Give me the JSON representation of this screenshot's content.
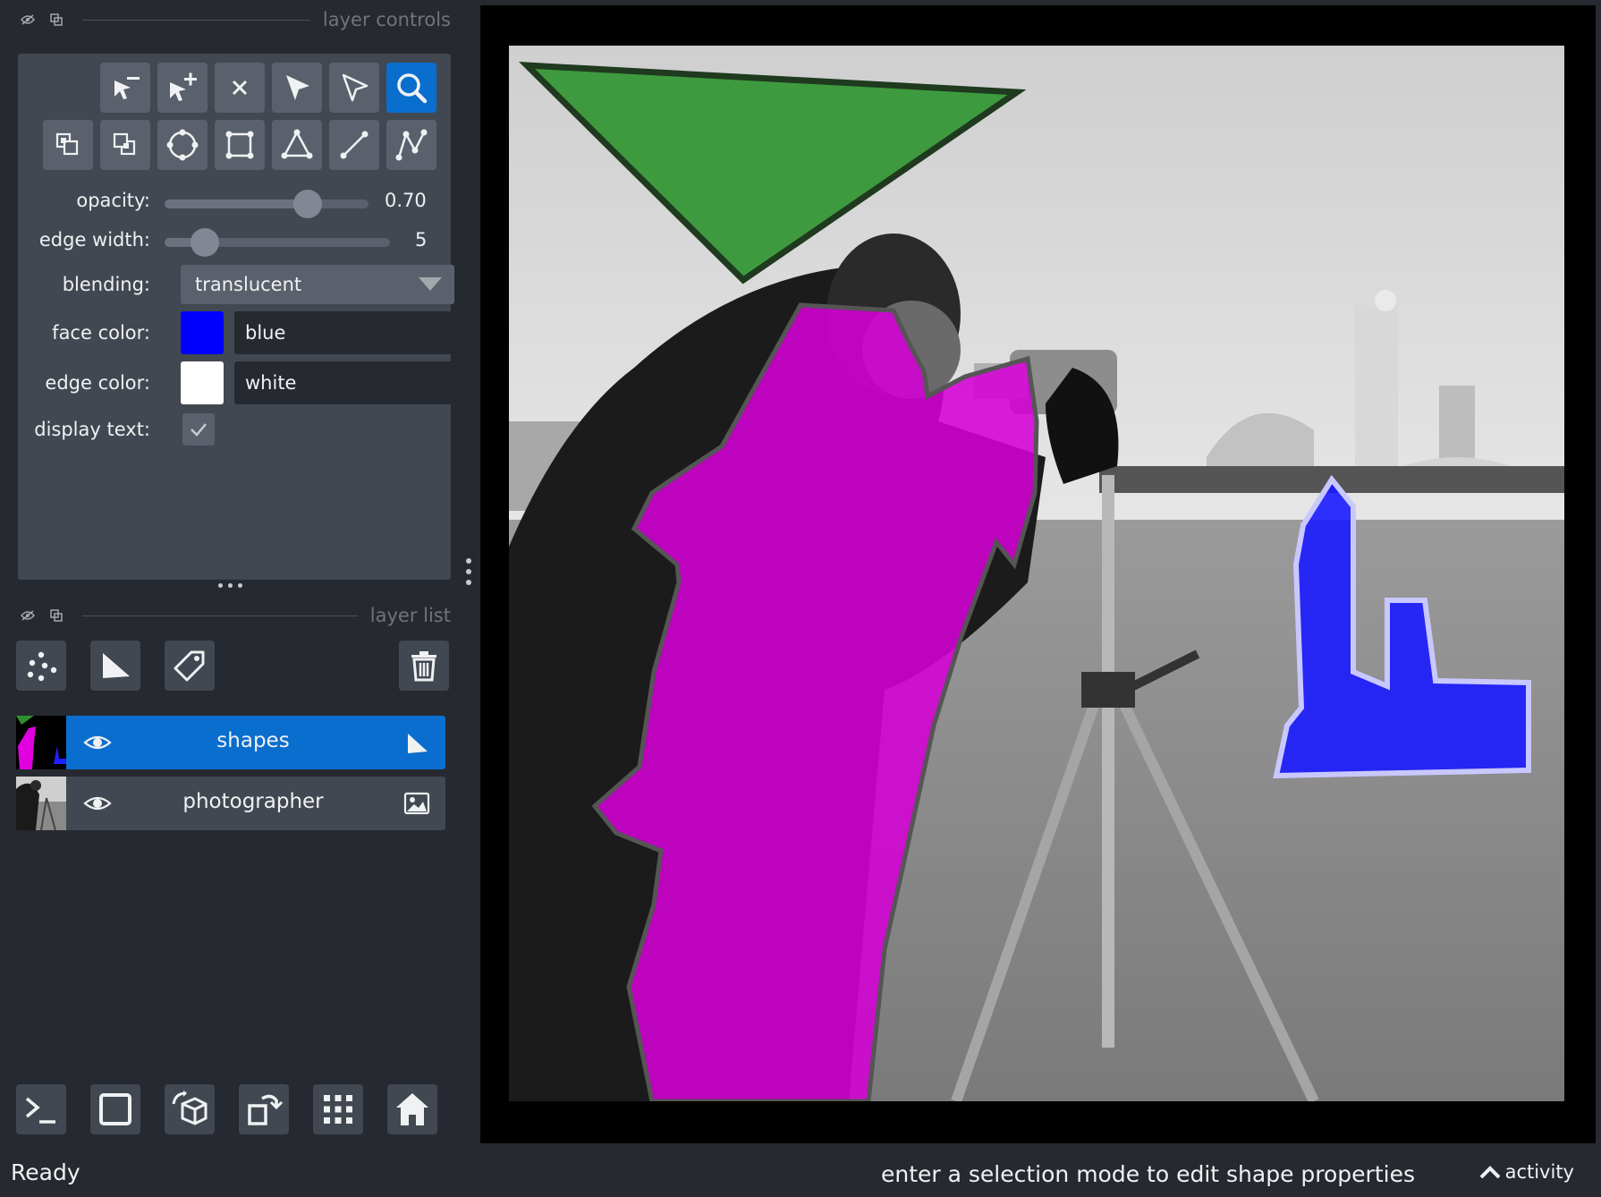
{
  "layer_controls": {
    "title": "layer controls",
    "opacity_label": "opacity:",
    "opacity_value": "0.70",
    "opacity_fraction": 0.7,
    "edge_width_label": "edge width:",
    "edge_width_value": "5",
    "edge_width_fraction": 0.18,
    "blending_label": "blending:",
    "blending_value": "translucent",
    "face_color_label": "face color:",
    "face_color_value": "blue",
    "face_color_hex": "#0000ff",
    "edge_color_label": "edge color:",
    "edge_color_value": "white",
    "edge_color_hex": "#ffffff",
    "display_text_label": "display text:",
    "display_text_checked": true,
    "tools_row1": [
      "delete-vertex-icon",
      "add-vertex-icon",
      "delete-shape-icon",
      "select-icon",
      "direct-select-icon",
      "pan-zoom-icon"
    ],
    "tools_row2": [
      "move-back-icon",
      "move-front-icon",
      "ellipse-icon",
      "rectangle-icon",
      "polygon-icon",
      "line-icon",
      "path-icon"
    ]
  },
  "layer_list": {
    "title": "layer list",
    "layers": [
      {
        "name": "shapes",
        "selected": true,
        "visible": true,
        "kind": "shapes-icon"
      },
      {
        "name": "photographer",
        "selected": false,
        "visible": true,
        "kind": "image-icon"
      }
    ]
  },
  "status": {
    "left": "Ready",
    "message": "enter a selection mode to edit shape properties",
    "activity": "activity"
  },
  "colors": {
    "accent": "#0a6ecf",
    "background": "#262930",
    "panel": "#414851",
    "button": "#5a616c",
    "triangle_fill": "#3e9a3e",
    "magenta_fill": "#d400d4",
    "blue_fill": "#1a1aff"
  }
}
